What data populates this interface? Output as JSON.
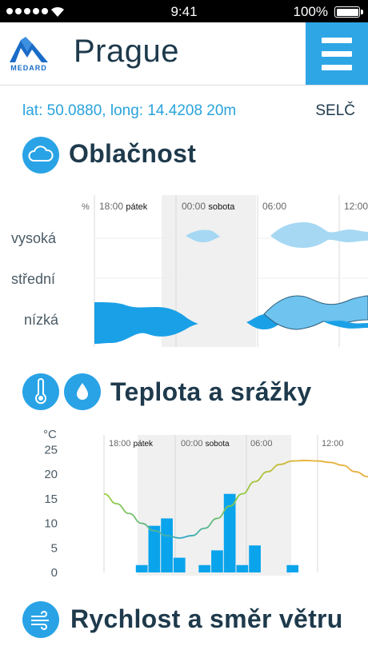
{
  "status_bar": {
    "time": "9:41",
    "battery": "100%"
  },
  "header": {
    "logo_text": "MEDARD",
    "city": "Prague"
  },
  "location": {
    "coords": "lat: 50.0880, long: 14.4208 20m",
    "timezone": "SELČ"
  },
  "sections": {
    "clouds": {
      "title": "Oblačnost"
    },
    "temperature": {
      "title": "Teplota a srážky"
    },
    "wind": {
      "title": "Rychlost a směr větru"
    }
  },
  "cloud_chart": {
    "unit": "%",
    "time_labels": [
      {
        "time": "18:00",
        "day": "pátek"
      },
      {
        "time": "00:00",
        "day": "sobota"
      },
      {
        "time": "06:00",
        "day": ""
      },
      {
        "time": "12:00",
        "day": ""
      }
    ],
    "levels": [
      "vysoká",
      "střední",
      "nízká"
    ]
  },
  "chart_data": {
    "type": "bar",
    "ylabel": "°C",
    "yticks": [
      0,
      5,
      10,
      15,
      20,
      25
    ],
    "ylim": [
      0,
      28
    ],
    "time_labels": [
      {
        "time": "18:00",
        "day": "pátek"
      },
      {
        "time": "00:00",
        "day": "sobota"
      },
      {
        "time": "06:00",
        "day": ""
      },
      {
        "time": "12:00",
        "day": ""
      }
    ],
    "temperature": [
      16,
      14,
      12,
      10,
      8.5,
      7.5,
      7,
      7.5,
      9,
      11,
      13.5,
      16,
      18.5,
      20.5,
      22,
      22.7,
      22.8,
      22.7,
      22.4,
      21.8,
      20.5,
      19.5
    ],
    "precipitation": [
      0,
      0,
      0,
      1.5,
      9.5,
      11,
      3,
      0,
      1.5,
      4.5,
      16,
      1.5,
      5.5,
      0,
      0,
      1.5,
      0,
      0,
      0,
      0,
      0,
      0
    ]
  }
}
